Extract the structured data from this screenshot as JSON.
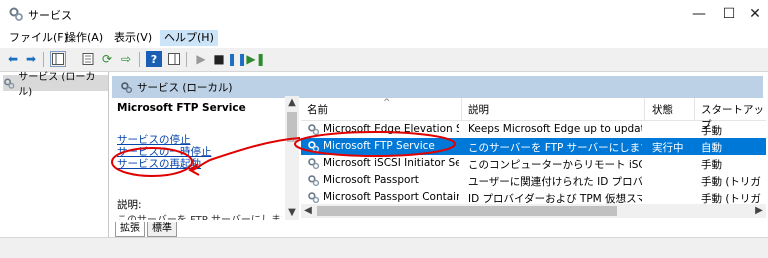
{
  "window": {
    "title": "サービス",
    "minimize_glyph": "—",
    "maximize_glyph": "☐",
    "close_glyph": "✕"
  },
  "menu": [
    "ファイル(F)",
    "操作(A)",
    "表示(V)",
    "ヘルプ(H)"
  ],
  "toolbar": {
    "icons": [
      "back-icon",
      "forward-icon",
      "console-tree-icon",
      "properties-icon",
      "refresh-icon",
      "export-icon",
      "help-icon",
      "show-hide-icon",
      "start-icon",
      "stop-icon",
      "pause-icon",
      "restart-icon"
    ]
  },
  "tree": {
    "root_label": "サービス (ローカル)"
  },
  "main": {
    "header_label": "サービス (ローカル)"
  },
  "description": {
    "service_name": "Microsoft FTP Service",
    "links": [
      "サービスの停止",
      "サービスの一時停止",
      "サービスの再起動"
    ],
    "label": "説明:",
    "text": "このサーバーを FTP サーバーにします。このサーバー"
  },
  "list": {
    "columns": [
      "名前",
      "説明",
      "状態",
      "スタートアップ"
    ],
    "sort_glyph": "^",
    "rows": [
      {
        "name": "Microsoft Edge Elevation Ser...",
        "desc": "Keeps Microsoft Edge up to update...",
        "status": "",
        "startup": "手動",
        "selected": false
      },
      {
        "name": "Microsoft FTP Service",
        "desc": "このサーバーを FTP サーバーにします。この...",
        "status": "実行中",
        "startup": "自動",
        "selected": true
      },
      {
        "name": "Microsoft iSCSI Initiator Servi...",
        "desc": "このコンピューターからリモート iSCSI ターゲ...",
        "status": "",
        "startup": "手動",
        "selected": false
      },
      {
        "name": "Microsoft Passport",
        "desc": "ユーザーに関連付けられた ID プロバイダ...",
        "status": "",
        "startup": "手動 (トリガ",
        "selected": false
      },
      {
        "name": "Microsoft Passport Container",
        "desc": "ID プロバイダーおよび TPM 仮想スマート...",
        "status": "",
        "startup": "手動 (トリガ",
        "selected": false
      }
    ]
  },
  "tabs": [
    "拡張",
    "標準"
  ],
  "colors": {
    "selection": "#0078d7",
    "header_band": "#bdd1e6",
    "link": "#0645ad",
    "annotation": "#e00000"
  }
}
